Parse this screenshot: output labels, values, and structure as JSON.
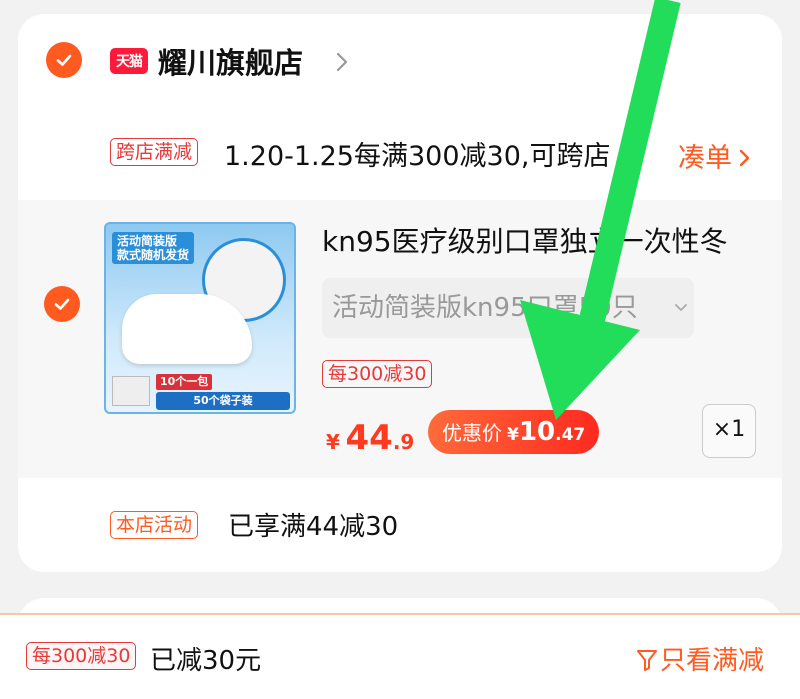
{
  "store": {
    "platform_badge": "天猫",
    "name": "耀川旗舰店"
  },
  "cross_store_promo": {
    "tag": "跨店满减",
    "text": "1.20-1.25每满300减30,可跨店",
    "action": "凑单"
  },
  "item": {
    "title": "kn95医疗级别口罩独立一次性冬",
    "spec": "活动简装版kn95口罩50只",
    "promo_tag": "每300减30",
    "price_symbol": "¥",
    "price_int": "44",
    "price_dec": ".9",
    "discount_label": "优惠价",
    "discount_symbol": "¥",
    "discount_int": "10",
    "discount_dec": ".47",
    "quantity": "×1",
    "thumbnail": {
      "banner_line1": "活动简装版",
      "banner_line2": "款式随机发货",
      "red_label": "10个一包",
      "bar_text": "50个袋子装"
    }
  },
  "shop_promo": {
    "tag": "本店活动",
    "text": "已享满44减30"
  },
  "bottom_bar": {
    "tag": "每300减30",
    "text": "已减30元",
    "filter_label": "只看满减"
  },
  "colors": {
    "accent": "#ff5a1f",
    "tag_red": "#e53a3a",
    "arrow_green": "#22dd5a"
  }
}
